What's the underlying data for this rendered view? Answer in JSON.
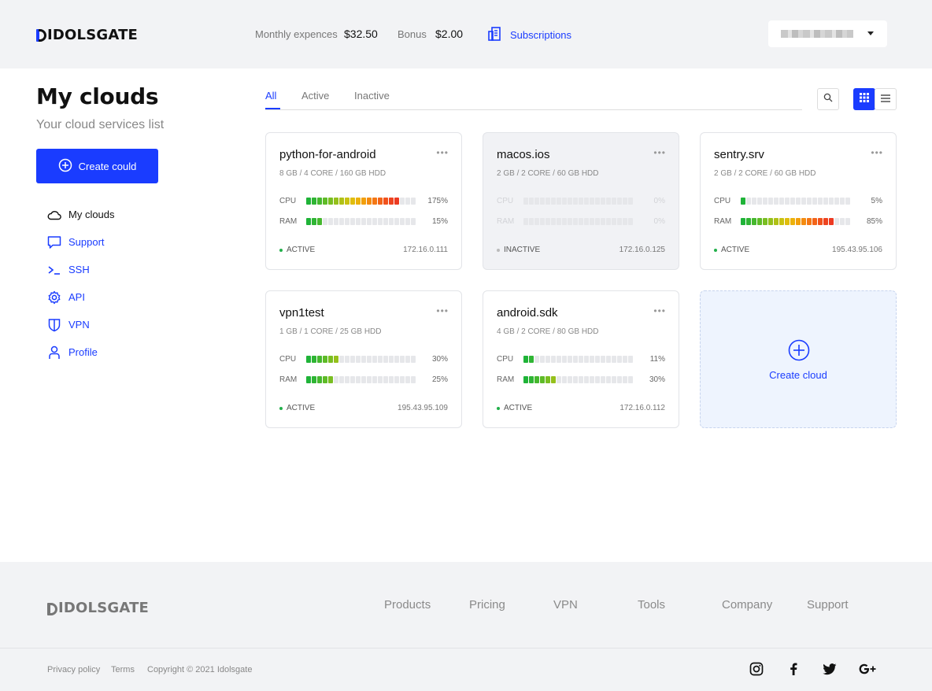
{
  "header": {
    "brand": "IDOLSGATE",
    "monthly_label": "Monthly expences",
    "monthly_value": "$32.50",
    "bonus_label": "Bonus",
    "bonus_value": "$2.00",
    "subscriptions_label": "Subscriptions",
    "user_menu": "(blurred)"
  },
  "sidebar": {
    "title": "My clouds",
    "subtitle": "Your cloud services list",
    "create_button": "Create could",
    "items": [
      {
        "label": "My clouds",
        "icon": "cloud-icon",
        "active": true
      },
      {
        "label": "Support",
        "icon": "chat-icon",
        "active": false
      },
      {
        "label": "SSH",
        "icon": "terminal-icon",
        "active": false
      },
      {
        "label": "API",
        "icon": "gear-icon",
        "active": false
      },
      {
        "label": "VPN",
        "icon": "shield-icon",
        "active": false
      },
      {
        "label": "Profile",
        "icon": "user-icon",
        "active": false
      }
    ]
  },
  "tabs": [
    {
      "label": "All",
      "active": true
    },
    {
      "label": "Active",
      "active": false
    },
    {
      "label": "Inactive",
      "active": false
    }
  ],
  "toolbar": {
    "search_icon": "search-icon",
    "grid_icon": "grid-view-icon",
    "list_icon": "list-view-icon",
    "view": "grid"
  },
  "cards": [
    {
      "name": "python-for-android",
      "spec": "8 GB / 4 CORE / 160 GB HDD",
      "cpu": 175,
      "cpu_text": "175%",
      "ram": 15,
      "ram_text": "15%",
      "status": "ACTIVE",
      "ip": "172.16.0.111"
    },
    {
      "name": "macos.ios",
      "spec": "2 GB / 2 CORE / 60 GB HDD",
      "cpu": 0,
      "cpu_text": "0%",
      "ram": 0,
      "ram_text": "0%",
      "status": "INACTIVE",
      "ip": "172.16.0.125"
    },
    {
      "name": "sentry.srv",
      "spec": "2 GB / 2 CORE / 60 GB HDD",
      "cpu": 5,
      "cpu_text": "5%",
      "ram": 85,
      "ram_text": "85%",
      "status": "ACTIVE",
      "ip": "195.43.95.106"
    },
    {
      "name": "vpn1test",
      "spec": "1 GB / 1 CORE / 25 GB HDD",
      "cpu": 30,
      "cpu_text": "30%",
      "ram": 25,
      "ram_text": "25%",
      "status": "ACTIVE",
      "ip": "195.43.95.109"
    },
    {
      "name": "android.sdk",
      "spec": "4 GB / 2 CORE / 80 GB HDD",
      "cpu": 11,
      "cpu_text": "11%",
      "ram": 30,
      "ram_text": "30%",
      "status": "ACTIVE",
      "ip": "172.16.0.112"
    }
  ],
  "metric_labels": {
    "cpu": "CPU",
    "ram": "RAM"
  },
  "create_card_label": "Create cloud",
  "footer": {
    "brand": "IDOLSGATE",
    "links": [
      "Products",
      "Pricing",
      "VPN",
      "Tools",
      "Company",
      "Support"
    ],
    "privacy": "Privacy policy",
    "terms": "Terms",
    "copyright": "Copyright © 2021 Idolsgate",
    "social": [
      "instagram-icon",
      "facebook-icon",
      "twitter-icon",
      "google-plus-icon"
    ]
  },
  "colors": {
    "accent": "#1a3cff",
    "active_dot": "#22b04b"
  }
}
